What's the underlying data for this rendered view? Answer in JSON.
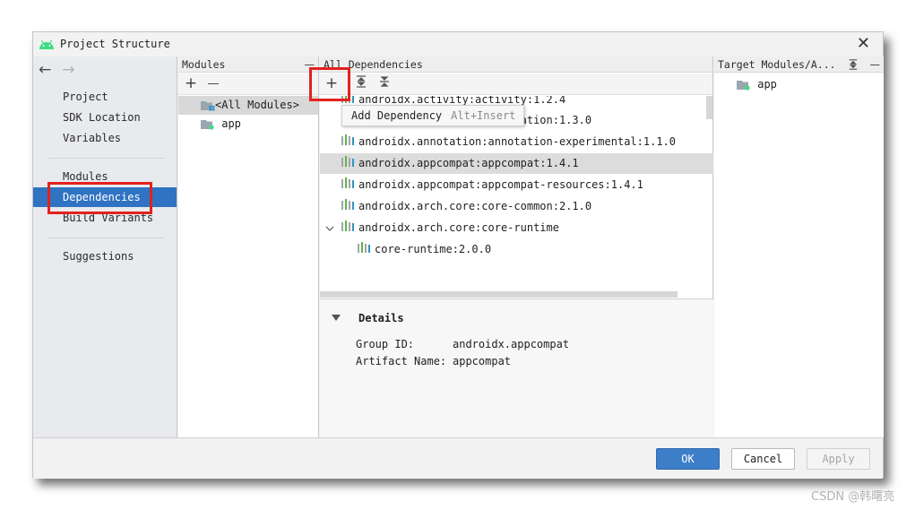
{
  "window": {
    "title": "Project Structure",
    "close_glyph": "✕"
  },
  "nav": {
    "back_glyph": "←",
    "forward_glyph": "→"
  },
  "sidebar": {
    "items": [
      {
        "label": "Project"
      },
      {
        "label": "SDK Location"
      },
      {
        "label": "Variables"
      },
      {
        "label": "Modules"
      },
      {
        "label": "Dependencies",
        "selected": true
      },
      {
        "label": "Build Variants"
      },
      {
        "label": "Suggestions"
      }
    ]
  },
  "modules_panel": {
    "header": "Modules",
    "header_action": "—",
    "add_glyph": "+",
    "remove_glyph": "—",
    "items": [
      {
        "label": "<All Modules>",
        "selected": true
      },
      {
        "label": "app"
      }
    ]
  },
  "dependencies_panel": {
    "header": "All Dependencies",
    "add_glyph": "+",
    "tooltip": {
      "label": "Add Dependency",
      "shortcut": "Alt+Insert"
    },
    "rows": [
      {
        "label": "androidx.activity:activity:1.2.4"
      },
      {
        "label": "androidx.annotation:annotation:1.3.0"
      },
      {
        "label": "androidx.annotation:annotation-experimental:1.1.0"
      },
      {
        "label": "androidx.appcompat:appcompat:1.4.1",
        "selected": true
      },
      {
        "label": "androidx.appcompat:appcompat-resources:1.4.1"
      },
      {
        "label": "androidx.arch.core:core-common:2.1.0"
      },
      {
        "label": "androidx.arch.core:core-runtime",
        "expanded": true
      },
      {
        "label": "core-runtime:2.0.0",
        "child": true
      }
    ],
    "details": {
      "heading": "Details",
      "fields": [
        {
          "key": "Group ID:",
          "value": "androidx.appcompat"
        },
        {
          "key": "Artifact Name:",
          "value": "appcompat"
        }
      ]
    }
  },
  "target_panel": {
    "header": "Target Modules/A...",
    "header_action": "—",
    "items": [
      {
        "label": "app"
      }
    ]
  },
  "footer": {
    "ok": "OK",
    "cancel": "Cancel",
    "apply": "Apply"
  },
  "watermark": "CSDN @韩曙亮",
  "colors": {
    "selection": "#2f73c2",
    "highlight": "#e2221e",
    "primary_button": "#3d7ec9"
  },
  "icons": [
    "android-logo-icon",
    "close-icon",
    "back-arrow-icon",
    "forward-arrow-icon",
    "folder-module-icon",
    "library-icon",
    "expand-all-icon",
    "collapse-all-icon"
  ]
}
